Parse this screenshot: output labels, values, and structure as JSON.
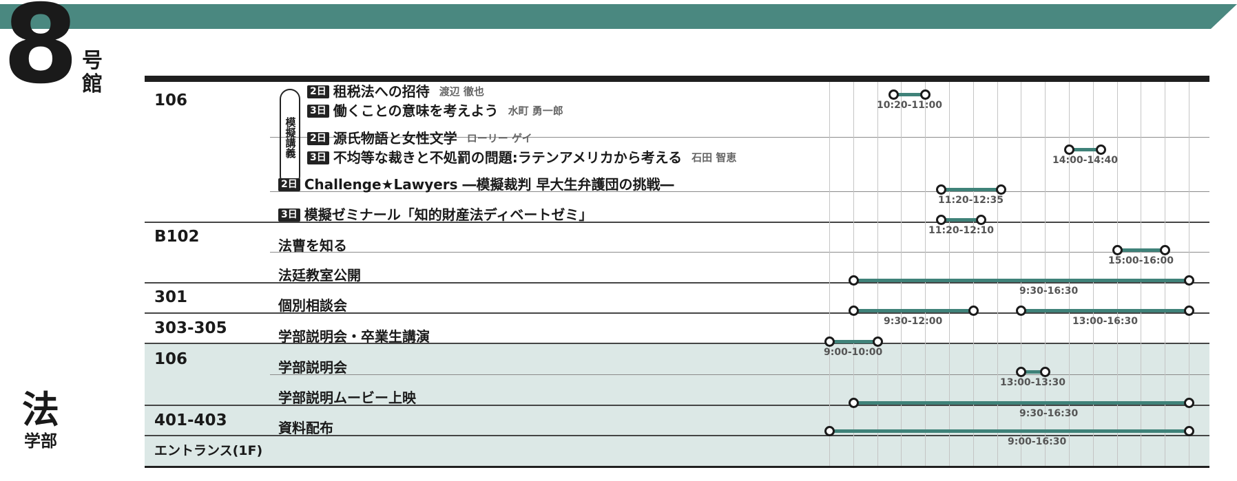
{
  "header": {
    "building_number": "8",
    "building_suffix": "号館",
    "bar_color": "#4a8880"
  },
  "faculty": {
    "name_large": "法",
    "name_small": "学部"
  },
  "bracket_label": "模擬講義",
  "time_axis": {
    "start": "9:00",
    "end": "16:30",
    "tick_interval_minutes": 30
  },
  "colors": {
    "accent": "#3f8279",
    "shade": "#dce8e6"
  },
  "rooms": [
    "106",
    "B102",
    "301",
    "303-305",
    "106",
    "401-403",
    "エントランス(1F)"
  ],
  "events": [
    {
      "room": "106",
      "day": "2日",
      "title": "租税法への招待",
      "lecturer": "渡辺 徹也",
      "time": "10:20-11:00",
      "start": "10:20",
      "end": "11:00"
    },
    {
      "room": "106",
      "day": "3日",
      "title": "働くことの意味を考えよう",
      "lecturer": "水町 勇一郎",
      "time": "",
      "start": "10:20",
      "end": "11:00"
    },
    {
      "room": "106",
      "day": "2日",
      "title": "源氏物語と女性文学",
      "lecturer": "ローリー ゲイ",
      "time": "14:00-14:40",
      "start": "14:00",
      "end": "14:40"
    },
    {
      "room": "106",
      "day": "3日",
      "title": "不均等な裁きと不処罰の問題:ラテンアメリカから考える",
      "lecturer": "石田 智恵",
      "time": "",
      "start": "14:00",
      "end": "14:40"
    },
    {
      "room": "106",
      "day": "2日",
      "title": "Challenge★Lawyers ―模擬裁判 早大生弁護団の挑戦―",
      "lecturer": "",
      "time": "11:20-12:35",
      "start": "11:20",
      "end": "12:35"
    },
    {
      "room": "B102",
      "day": "3日",
      "title": "模擬ゼミナール「知的財産法ディベートゼミ」",
      "lecturer": "",
      "time": "11:20-12:10",
      "start": "11:20",
      "end": "12:10"
    },
    {
      "room": "B102",
      "day": "",
      "title": "法曹を知る",
      "lecturer": "",
      "time": "15:00-16:00",
      "start": "15:00",
      "end": "16:00"
    },
    {
      "room": "301",
      "day": "",
      "title": "法廷教室公開",
      "lecturer": "",
      "time": "9:30-16:30",
      "start": "9:30",
      "end": "16:30"
    },
    {
      "room": "303-305",
      "day": "",
      "title": "個別相談会",
      "lecturer": "",
      "time": "9:30-12:00",
      "start": "9:30",
      "end": "12:00",
      "time2": "13:00-16:30",
      "start2": "13:00",
      "end2": "16:30"
    },
    {
      "room": "106",
      "day": "",
      "title": "学部説明会・卒業生講演",
      "lecturer": "",
      "time": "9:00-10:00",
      "start": "9:00",
      "end": "10:00"
    },
    {
      "room": "106",
      "day": "",
      "title": "学部説明会",
      "lecturer": "",
      "time": "13:00-13:30",
      "start": "13:00",
      "end": "13:30"
    },
    {
      "room": "401-403",
      "day": "",
      "title": "学部説明ムービー上映",
      "lecturer": "",
      "time": "9:30-16:30",
      "start": "9:30",
      "end": "16:30"
    },
    {
      "room": "エントランス(1F)",
      "day": "",
      "title": "資料配布",
      "lecturer": "",
      "time": "9:00-16:30",
      "start": "9:00",
      "end": "16:30"
    }
  ]
}
